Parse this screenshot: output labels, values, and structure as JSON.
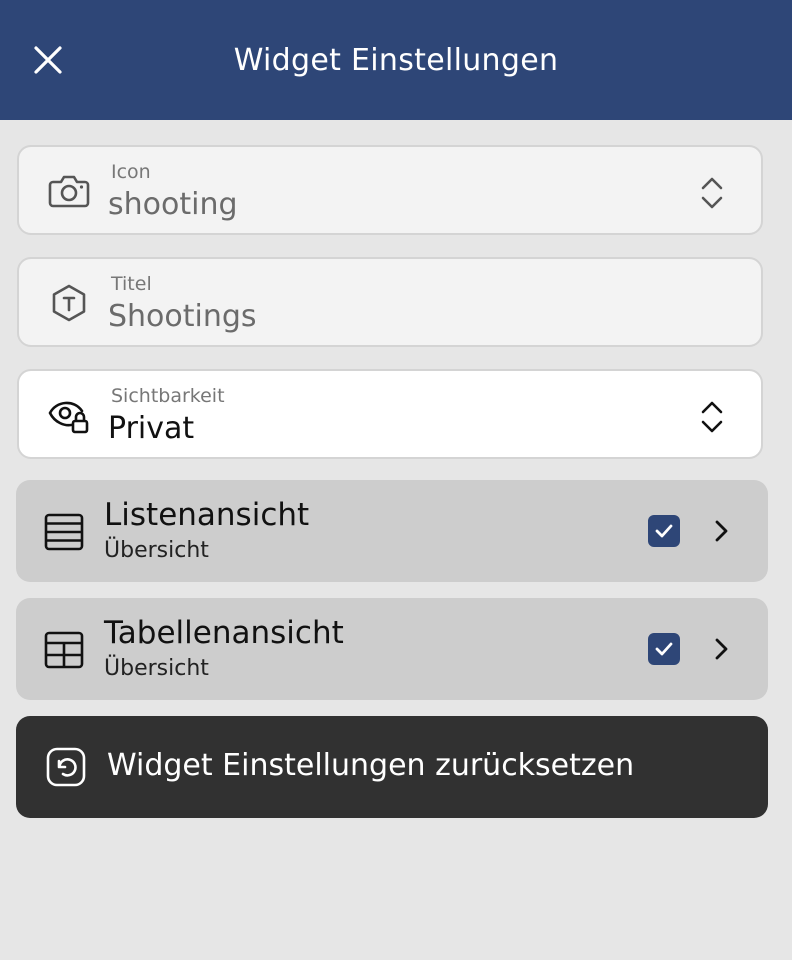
{
  "header": {
    "title": "Widget Einstellungen",
    "close_icon": "close-icon"
  },
  "fields": {
    "icon": {
      "label": "Icon",
      "value": "shooting",
      "icon": "camera-icon"
    },
    "title": {
      "label": "Titel",
      "value": "Shootings",
      "icon": "title-hexagon-icon"
    },
    "visibility": {
      "label": "Sichtbarkeit",
      "value": "Privat",
      "icon": "eye-lock-icon"
    }
  },
  "views": [
    {
      "title": "Listenansicht",
      "subtitle": "Übersicht",
      "checked": true,
      "icon": "list-icon"
    },
    {
      "title": "Tabellenansicht",
      "subtitle": "Übersicht",
      "checked": true,
      "icon": "table-icon"
    }
  ],
  "reset": {
    "label": "Widget Einstellungen zurücksetzen",
    "icon": "reset-icon"
  },
  "colors": {
    "header": "#2e4677",
    "background": "#e6e6e6",
    "checkbox": "#2e4677",
    "reset_button": "#313131"
  }
}
